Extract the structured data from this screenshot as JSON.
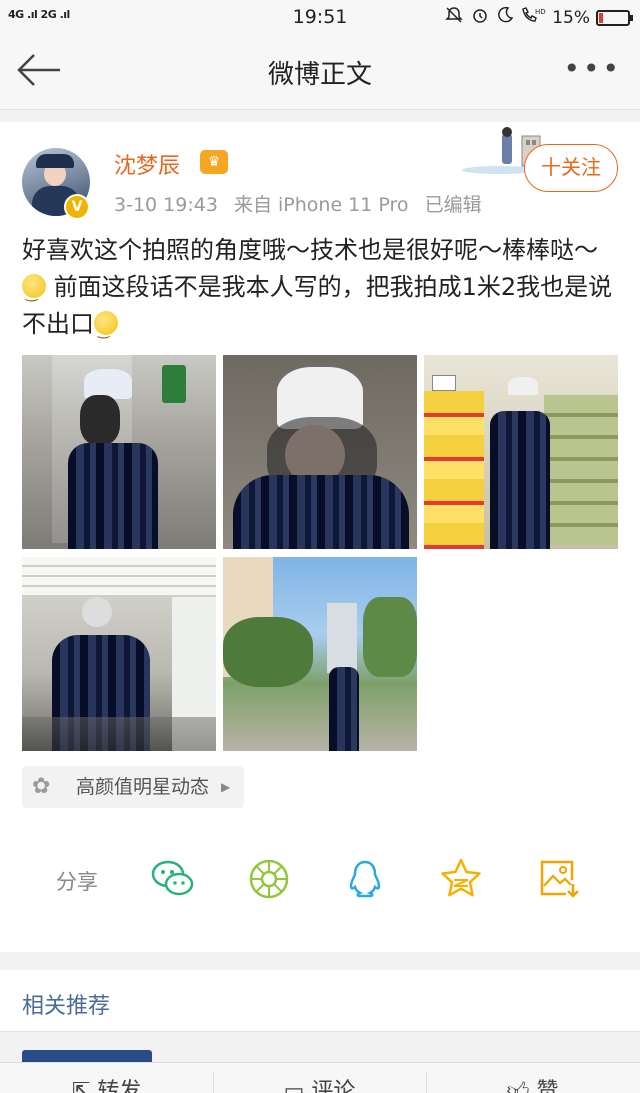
{
  "status_bar": {
    "signal_text": "4G .ıl 2G .ıl",
    "time": "19:51",
    "battery_percent": "15%",
    "battery_level": 0.15,
    "battery_color": "#e53935"
  },
  "nav": {
    "title": "微博正文",
    "back_icon": "arrow-left-icon",
    "more_label": "•••"
  },
  "post": {
    "username": "沈梦辰",
    "username_color": "#e8681e",
    "crown_label": "♛",
    "verified_label": "V",
    "timestamp": "3-10 19:43",
    "source": "来自 iPhone 11 Pro",
    "edited": "已编辑",
    "follow_label": "十关注",
    "text_part1": "好喜欢这个拍照的角度哦～技术也是很好呢～棒棒哒～",
    "text_part2": " 前面这段话不是我本人写的，把我拍成1米2我也是说不出口",
    "photo_count": 5
  },
  "topic": {
    "icon": "flower-icon",
    "label": "高颜值明星动态",
    "arrow": "▶"
  },
  "share": {
    "label": "分享",
    "icons": [
      "wechat-icon",
      "moments-icon",
      "qq-icon",
      "qzone-star-icon",
      "save-image-icon"
    ],
    "colors": {
      "wechat": "#25b37a",
      "moments": "#8fc83f",
      "qq": "#29a8e2",
      "star": "#f5b100",
      "save": "#f0a500"
    }
  },
  "related": {
    "label": "相关推荐"
  },
  "bottom_bar": {
    "repost": "转发",
    "comment": "评论",
    "like": "赞"
  }
}
